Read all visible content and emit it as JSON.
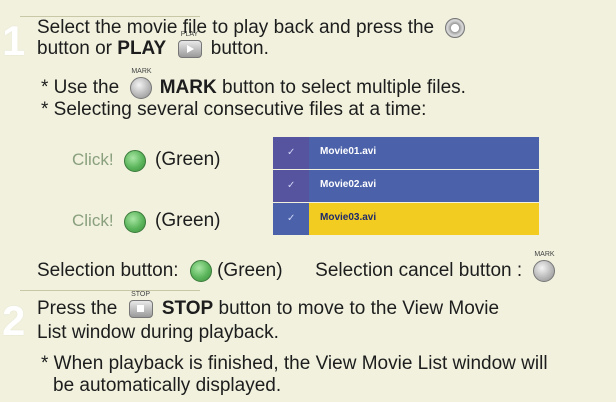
{
  "steps": {
    "one": {
      "number": "1",
      "line1": "Select the movie file to play back and press the",
      "line2_pre": "button or",
      "play_bold": "PLAY",
      "play_btn_label": "PLAY",
      "line2_post": "button.",
      "note1_pre": "* Use the",
      "mark_btn_label": "MARK",
      "note1_bold": "MARK",
      "note1_post": "button to select multiple files.",
      "note2": "* Selecting several consecutive files at a time:"
    },
    "two": {
      "number": "2",
      "line1_pre": "Press the",
      "stop_btn_label": "STOP",
      "stop_bold": "STOP",
      "line1_post": "button to move to the View Movie",
      "line2": "List window during playback.",
      "note1": "* When playback is finished, the View Movie List window will",
      "note1_cont": "be automatically displayed."
    }
  },
  "selection_demo": {
    "click_label_1": "Click!",
    "green_label_1": "(Green)",
    "click_label_2": "Click!",
    "green_label_2": "(Green)",
    "files": [
      {
        "name": "Movie01.avi",
        "check": "✓",
        "selected": false
      },
      {
        "name": "Movie02.avi",
        "check": "✓",
        "selected": false
      },
      {
        "name": "Movie03.avi",
        "check": "✓",
        "selected": true
      }
    ],
    "row_colors": {
      "normal": "#4b62aa",
      "selected": "#f3cc22"
    }
  },
  "legend": {
    "selection_label": "Selection button:",
    "selection_color": "(Green)",
    "cancel_label": "Selection cancel button :",
    "cancel_btn_label": "MARK"
  },
  "colors": {
    "background": "#f1f1de",
    "green_button": "#5bb55b",
    "click_text": "#8aa07d"
  }
}
